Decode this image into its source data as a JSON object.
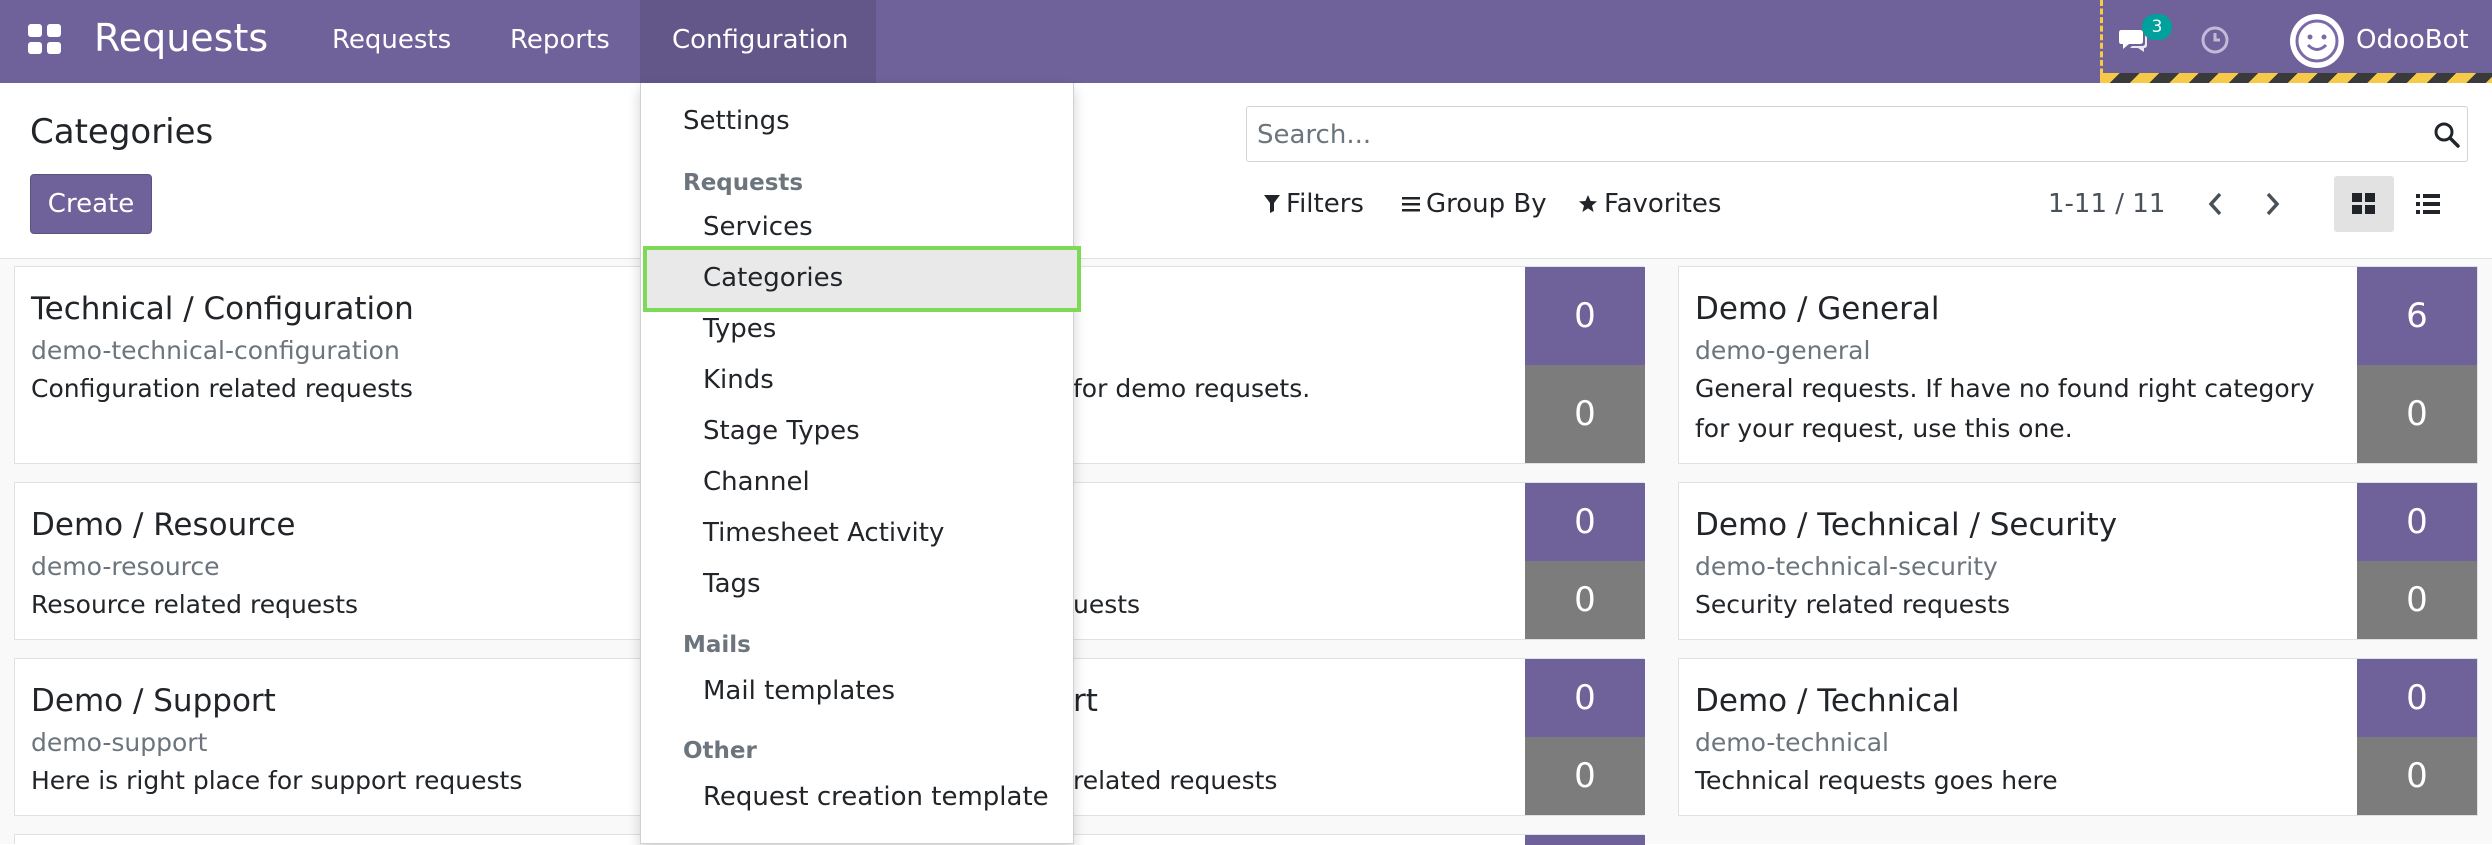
{
  "navbar": {
    "app_title": "Requests",
    "menu": [
      "Requests",
      "Reports",
      "Configuration"
    ],
    "chat_count": "3",
    "user_name": "OdooBot"
  },
  "control_panel": {
    "title": "Categories",
    "create_label": "Create",
    "search_placeholder": "Search...",
    "filters_label": "Filters",
    "group_by_label": "Group By",
    "favorites_label": "Favorites",
    "pager": "1-11 / 11"
  },
  "dropdown": {
    "settings": "Settings",
    "section_requests": "Requests",
    "services": "Services",
    "categories": "Categories",
    "types": "Types",
    "kinds": "Kinds",
    "stage_types": "Stage Types",
    "channel": "Channel",
    "timesheet_activity": "Timesheet Activity",
    "tags": "Tags",
    "section_mails": "Mails",
    "mail_templates": "Mail templates",
    "section_other": "Other",
    "request_creation_template": "Request creation template"
  },
  "cards": [
    {
      "title": "Technical / Configuration",
      "code": "demo-technical-configuration",
      "desc": "Configuration related requests",
      "open": "",
      "closed": ""
    },
    {
      "title": "",
      "code": "",
      "desc": "for demo requsets.",
      "open": "0",
      "closed": "0"
    },
    {
      "title": "Demo / General",
      "code": "demo-general",
      "desc": "General requests. If have no found right category for your request, use this one.",
      "open": "6",
      "closed": "0"
    },
    {
      "title": "Demo / Resource",
      "code": "demo-resource",
      "desc": "Resource related requests",
      "open": "",
      "closed": ""
    },
    {
      "title": "",
      "code": "",
      "desc": "uests",
      "open": "0",
      "closed": "0"
    },
    {
      "title": "Demo / Technical / Security",
      "code": "demo-technical-security",
      "desc": "Security related requests",
      "open": "0",
      "closed": "0"
    },
    {
      "title": "Demo / Support",
      "code": "demo-support",
      "desc": "Here is right place for support requests",
      "open": "",
      "closed": ""
    },
    {
      "title": "rt",
      "code": "",
      "desc": "related requests",
      "open": "0",
      "closed": "0"
    },
    {
      "title": "Demo / Technical",
      "code": "demo-technical",
      "desc": "Technical requests goes here",
      "open": "0",
      "closed": "0"
    }
  ]
}
